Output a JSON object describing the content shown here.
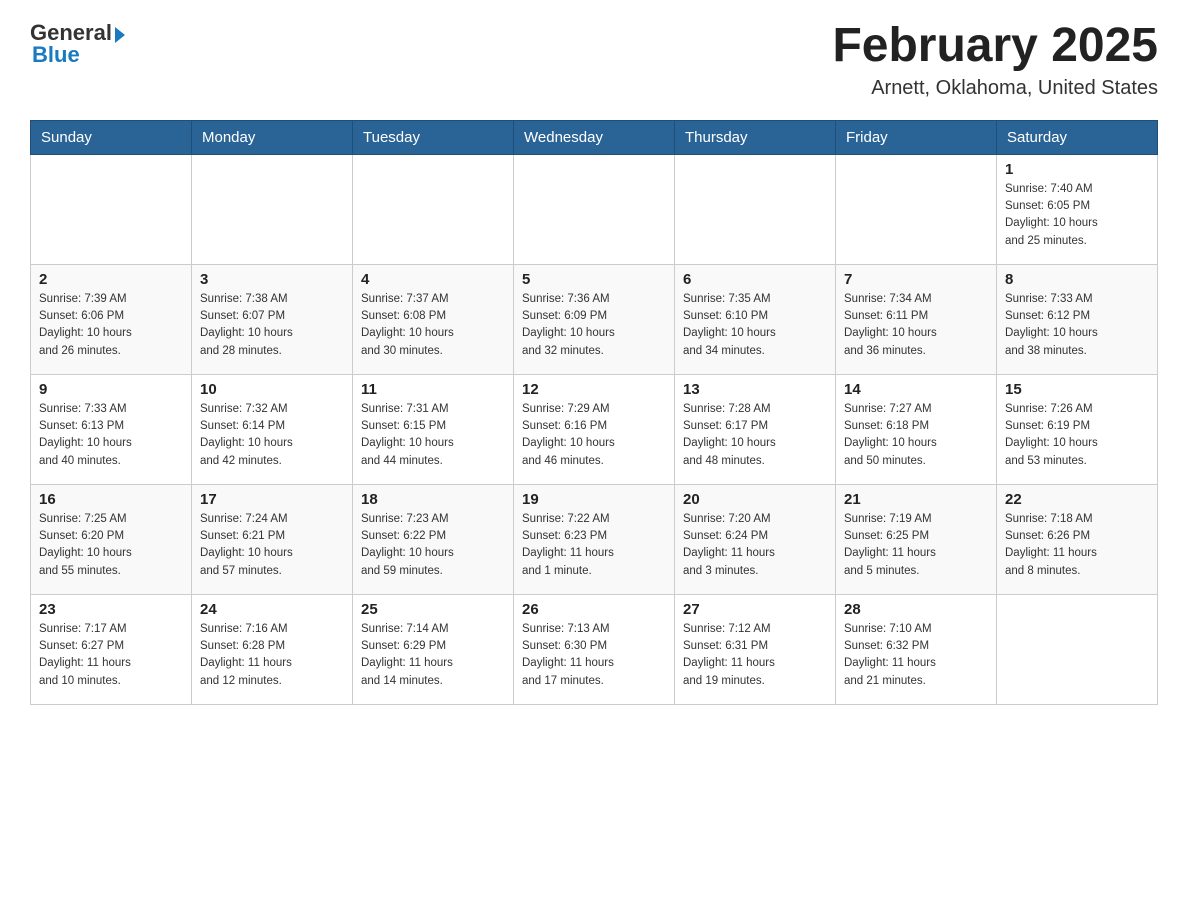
{
  "header": {
    "logo": {
      "general": "General",
      "blue": "Blue"
    },
    "title": "February 2025",
    "subtitle": "Arnett, Oklahoma, United States"
  },
  "days_of_week": [
    "Sunday",
    "Monday",
    "Tuesday",
    "Wednesday",
    "Thursday",
    "Friday",
    "Saturday"
  ],
  "weeks": [
    {
      "row_class": "week-row-1",
      "days": [
        {
          "number": "",
          "info": ""
        },
        {
          "number": "",
          "info": ""
        },
        {
          "number": "",
          "info": ""
        },
        {
          "number": "",
          "info": ""
        },
        {
          "number": "",
          "info": ""
        },
        {
          "number": "",
          "info": ""
        },
        {
          "number": "1",
          "info": "Sunrise: 7:40 AM\nSunset: 6:05 PM\nDaylight: 10 hours\nand 25 minutes."
        }
      ]
    },
    {
      "row_class": "week-row-2",
      "days": [
        {
          "number": "2",
          "info": "Sunrise: 7:39 AM\nSunset: 6:06 PM\nDaylight: 10 hours\nand 26 minutes."
        },
        {
          "number": "3",
          "info": "Sunrise: 7:38 AM\nSunset: 6:07 PM\nDaylight: 10 hours\nand 28 minutes."
        },
        {
          "number": "4",
          "info": "Sunrise: 7:37 AM\nSunset: 6:08 PM\nDaylight: 10 hours\nand 30 minutes."
        },
        {
          "number": "5",
          "info": "Sunrise: 7:36 AM\nSunset: 6:09 PM\nDaylight: 10 hours\nand 32 minutes."
        },
        {
          "number": "6",
          "info": "Sunrise: 7:35 AM\nSunset: 6:10 PM\nDaylight: 10 hours\nand 34 minutes."
        },
        {
          "number": "7",
          "info": "Sunrise: 7:34 AM\nSunset: 6:11 PM\nDaylight: 10 hours\nand 36 minutes."
        },
        {
          "number": "8",
          "info": "Sunrise: 7:33 AM\nSunset: 6:12 PM\nDaylight: 10 hours\nand 38 minutes."
        }
      ]
    },
    {
      "row_class": "week-row-3",
      "days": [
        {
          "number": "9",
          "info": "Sunrise: 7:33 AM\nSunset: 6:13 PM\nDaylight: 10 hours\nand 40 minutes."
        },
        {
          "number": "10",
          "info": "Sunrise: 7:32 AM\nSunset: 6:14 PM\nDaylight: 10 hours\nand 42 minutes."
        },
        {
          "number": "11",
          "info": "Sunrise: 7:31 AM\nSunset: 6:15 PM\nDaylight: 10 hours\nand 44 minutes."
        },
        {
          "number": "12",
          "info": "Sunrise: 7:29 AM\nSunset: 6:16 PM\nDaylight: 10 hours\nand 46 minutes."
        },
        {
          "number": "13",
          "info": "Sunrise: 7:28 AM\nSunset: 6:17 PM\nDaylight: 10 hours\nand 48 minutes."
        },
        {
          "number": "14",
          "info": "Sunrise: 7:27 AM\nSunset: 6:18 PM\nDaylight: 10 hours\nand 50 minutes."
        },
        {
          "number": "15",
          "info": "Sunrise: 7:26 AM\nSunset: 6:19 PM\nDaylight: 10 hours\nand 53 minutes."
        }
      ]
    },
    {
      "row_class": "week-row-4",
      "days": [
        {
          "number": "16",
          "info": "Sunrise: 7:25 AM\nSunset: 6:20 PM\nDaylight: 10 hours\nand 55 minutes."
        },
        {
          "number": "17",
          "info": "Sunrise: 7:24 AM\nSunset: 6:21 PM\nDaylight: 10 hours\nand 57 minutes."
        },
        {
          "number": "18",
          "info": "Sunrise: 7:23 AM\nSunset: 6:22 PM\nDaylight: 10 hours\nand 59 minutes."
        },
        {
          "number": "19",
          "info": "Sunrise: 7:22 AM\nSunset: 6:23 PM\nDaylight: 11 hours\nand 1 minute."
        },
        {
          "number": "20",
          "info": "Sunrise: 7:20 AM\nSunset: 6:24 PM\nDaylight: 11 hours\nand 3 minutes."
        },
        {
          "number": "21",
          "info": "Sunrise: 7:19 AM\nSunset: 6:25 PM\nDaylight: 11 hours\nand 5 minutes."
        },
        {
          "number": "22",
          "info": "Sunrise: 7:18 AM\nSunset: 6:26 PM\nDaylight: 11 hours\nand 8 minutes."
        }
      ]
    },
    {
      "row_class": "week-row-5",
      "days": [
        {
          "number": "23",
          "info": "Sunrise: 7:17 AM\nSunset: 6:27 PM\nDaylight: 11 hours\nand 10 minutes."
        },
        {
          "number": "24",
          "info": "Sunrise: 7:16 AM\nSunset: 6:28 PM\nDaylight: 11 hours\nand 12 minutes."
        },
        {
          "number": "25",
          "info": "Sunrise: 7:14 AM\nSunset: 6:29 PM\nDaylight: 11 hours\nand 14 minutes."
        },
        {
          "number": "26",
          "info": "Sunrise: 7:13 AM\nSunset: 6:30 PM\nDaylight: 11 hours\nand 17 minutes."
        },
        {
          "number": "27",
          "info": "Sunrise: 7:12 AM\nSunset: 6:31 PM\nDaylight: 11 hours\nand 19 minutes."
        },
        {
          "number": "28",
          "info": "Sunrise: 7:10 AM\nSunset: 6:32 PM\nDaylight: 11 hours\nand 21 minutes."
        },
        {
          "number": "",
          "info": ""
        }
      ]
    }
  ]
}
